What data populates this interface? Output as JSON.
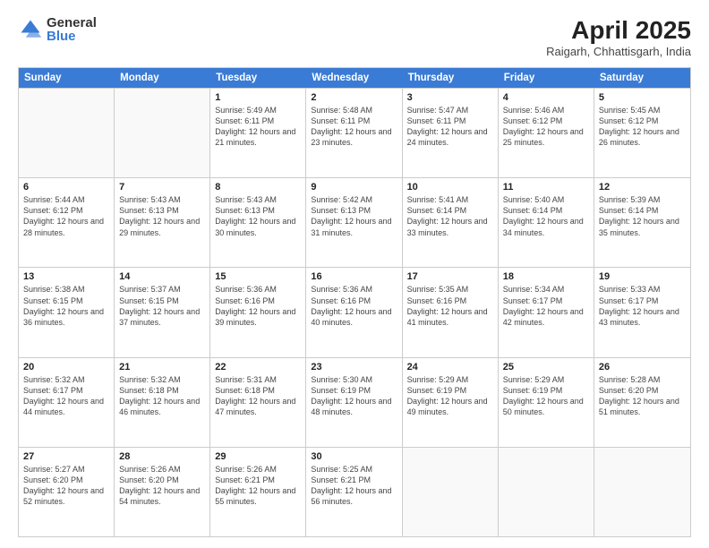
{
  "logo": {
    "general": "General",
    "blue": "Blue"
  },
  "title": {
    "month": "April 2025",
    "location": "Raigarh, Chhattisgarh, India"
  },
  "header_days": [
    "Sunday",
    "Monday",
    "Tuesday",
    "Wednesday",
    "Thursday",
    "Friday",
    "Saturday"
  ],
  "weeks": [
    [
      {
        "day": "",
        "info": ""
      },
      {
        "day": "",
        "info": ""
      },
      {
        "day": "1",
        "info": "Sunrise: 5:49 AM\nSunset: 6:11 PM\nDaylight: 12 hours and 21 minutes."
      },
      {
        "day": "2",
        "info": "Sunrise: 5:48 AM\nSunset: 6:11 PM\nDaylight: 12 hours and 23 minutes."
      },
      {
        "day": "3",
        "info": "Sunrise: 5:47 AM\nSunset: 6:11 PM\nDaylight: 12 hours and 24 minutes."
      },
      {
        "day": "4",
        "info": "Sunrise: 5:46 AM\nSunset: 6:12 PM\nDaylight: 12 hours and 25 minutes."
      },
      {
        "day": "5",
        "info": "Sunrise: 5:45 AM\nSunset: 6:12 PM\nDaylight: 12 hours and 26 minutes."
      }
    ],
    [
      {
        "day": "6",
        "info": "Sunrise: 5:44 AM\nSunset: 6:12 PM\nDaylight: 12 hours and 28 minutes."
      },
      {
        "day": "7",
        "info": "Sunrise: 5:43 AM\nSunset: 6:13 PM\nDaylight: 12 hours and 29 minutes."
      },
      {
        "day": "8",
        "info": "Sunrise: 5:43 AM\nSunset: 6:13 PM\nDaylight: 12 hours and 30 minutes."
      },
      {
        "day": "9",
        "info": "Sunrise: 5:42 AM\nSunset: 6:13 PM\nDaylight: 12 hours and 31 minutes."
      },
      {
        "day": "10",
        "info": "Sunrise: 5:41 AM\nSunset: 6:14 PM\nDaylight: 12 hours and 33 minutes."
      },
      {
        "day": "11",
        "info": "Sunrise: 5:40 AM\nSunset: 6:14 PM\nDaylight: 12 hours and 34 minutes."
      },
      {
        "day": "12",
        "info": "Sunrise: 5:39 AM\nSunset: 6:14 PM\nDaylight: 12 hours and 35 minutes."
      }
    ],
    [
      {
        "day": "13",
        "info": "Sunrise: 5:38 AM\nSunset: 6:15 PM\nDaylight: 12 hours and 36 minutes."
      },
      {
        "day": "14",
        "info": "Sunrise: 5:37 AM\nSunset: 6:15 PM\nDaylight: 12 hours and 37 minutes."
      },
      {
        "day": "15",
        "info": "Sunrise: 5:36 AM\nSunset: 6:16 PM\nDaylight: 12 hours and 39 minutes."
      },
      {
        "day": "16",
        "info": "Sunrise: 5:36 AM\nSunset: 6:16 PM\nDaylight: 12 hours and 40 minutes."
      },
      {
        "day": "17",
        "info": "Sunrise: 5:35 AM\nSunset: 6:16 PM\nDaylight: 12 hours and 41 minutes."
      },
      {
        "day": "18",
        "info": "Sunrise: 5:34 AM\nSunset: 6:17 PM\nDaylight: 12 hours and 42 minutes."
      },
      {
        "day": "19",
        "info": "Sunrise: 5:33 AM\nSunset: 6:17 PM\nDaylight: 12 hours and 43 minutes."
      }
    ],
    [
      {
        "day": "20",
        "info": "Sunrise: 5:32 AM\nSunset: 6:17 PM\nDaylight: 12 hours and 44 minutes."
      },
      {
        "day": "21",
        "info": "Sunrise: 5:32 AM\nSunset: 6:18 PM\nDaylight: 12 hours and 46 minutes."
      },
      {
        "day": "22",
        "info": "Sunrise: 5:31 AM\nSunset: 6:18 PM\nDaylight: 12 hours and 47 minutes."
      },
      {
        "day": "23",
        "info": "Sunrise: 5:30 AM\nSunset: 6:19 PM\nDaylight: 12 hours and 48 minutes."
      },
      {
        "day": "24",
        "info": "Sunrise: 5:29 AM\nSunset: 6:19 PM\nDaylight: 12 hours and 49 minutes."
      },
      {
        "day": "25",
        "info": "Sunrise: 5:29 AM\nSunset: 6:19 PM\nDaylight: 12 hours and 50 minutes."
      },
      {
        "day": "26",
        "info": "Sunrise: 5:28 AM\nSunset: 6:20 PM\nDaylight: 12 hours and 51 minutes."
      }
    ],
    [
      {
        "day": "27",
        "info": "Sunrise: 5:27 AM\nSunset: 6:20 PM\nDaylight: 12 hours and 52 minutes."
      },
      {
        "day": "28",
        "info": "Sunrise: 5:26 AM\nSunset: 6:20 PM\nDaylight: 12 hours and 54 minutes."
      },
      {
        "day": "29",
        "info": "Sunrise: 5:26 AM\nSunset: 6:21 PM\nDaylight: 12 hours and 55 minutes."
      },
      {
        "day": "30",
        "info": "Sunrise: 5:25 AM\nSunset: 6:21 PM\nDaylight: 12 hours and 56 minutes."
      },
      {
        "day": "",
        "info": ""
      },
      {
        "day": "",
        "info": ""
      },
      {
        "day": "",
        "info": ""
      }
    ]
  ]
}
